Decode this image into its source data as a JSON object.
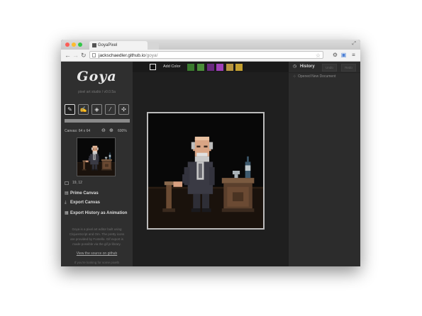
{
  "browser": {
    "tab_title": "GoyaPixel",
    "url_domain": "jackschaedler.github.io",
    "url_path": "/goya/"
  },
  "sidebar": {
    "logo": "Goya",
    "subtitle": "pixel art studio / v0.0.5a",
    "tools": [
      {
        "name": "pencil-icon",
        "glyph": "✎"
      },
      {
        "name": "edit-icon",
        "glyph": "✍"
      },
      {
        "name": "fill-bucket-icon",
        "glyph": "◈"
      },
      {
        "name": "eyedropper-icon",
        "glyph": "⁄"
      },
      {
        "name": "move-icon",
        "glyph": "✣"
      }
    ],
    "canvas_size": "Canvas: 64 x 64",
    "zoom_level": "600%",
    "coords": "19, 12",
    "actions": {
      "prime_canvas": "Prime Canvas",
      "export_canvas": "Export Canvas",
      "export_history": "Export History as Animation"
    },
    "info_text": "Goya is a pixel art editor built using ClojureScript and Om. The pretty icons are provided by Fontello. Gif export is made possible via the gif.js library.",
    "source_link": "View the source on github",
    "info_text_2": "If you're looking for some pixelb"
  },
  "main": {
    "add_color_label": "Add Color",
    "palette": [
      "#3a7a2e",
      "#4b8f3a",
      "#6a2a80",
      "#a040b8",
      "#b89640",
      "#c4a030"
    ]
  },
  "history": {
    "title": "History",
    "undo_label": "Undo",
    "redo_label": "Redo",
    "items": [
      "Opened New Document"
    ]
  }
}
